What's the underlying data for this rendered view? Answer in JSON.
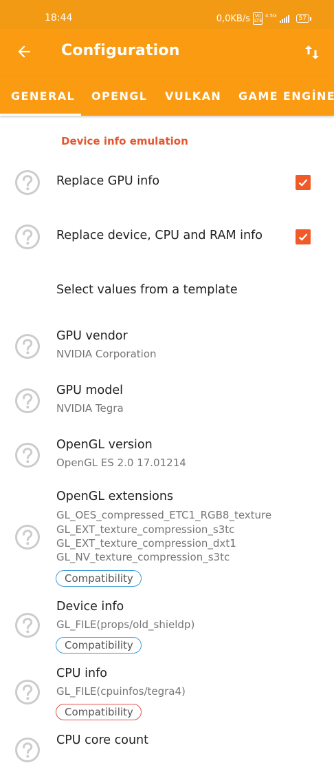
{
  "status_bar": {
    "time": "18:44",
    "speed": "0,0KB/s",
    "volte": "Vo LTE",
    "network": "4.5G",
    "battery": "57"
  },
  "app_bar": {
    "title": "Configuration",
    "back_icon": "arrow-left-icon",
    "sort_icon": "swap-vertical-icon"
  },
  "tabs": [
    {
      "label": "GENERAL",
      "selected": true
    },
    {
      "label": "OPENGL",
      "selected": false
    },
    {
      "label": "VULKAN",
      "selected": false
    },
    {
      "label": "GAME ENGİNE",
      "selected": false
    }
  ],
  "section": {
    "title": "Device info emulation"
  },
  "settings": {
    "replace_gpu": {
      "title": "Replace GPU info",
      "checked": true
    },
    "replace_device": {
      "title": "Replace device, CPU and RAM info",
      "checked": true
    },
    "template": {
      "title": "Select values from a template"
    },
    "gpu_vendor": {
      "title": "GPU vendor",
      "value": "NVIDIA Corporation"
    },
    "gpu_model": {
      "title": "GPU model",
      "value": "NVIDIA Tegra"
    },
    "opengl_version": {
      "title": "OpenGL version",
      "value": "OpenGL ES 2.0 17.01214"
    },
    "opengl_extensions": {
      "title": "OpenGL extensions",
      "values": [
        "GL_OES_compressed_ETC1_RGB8_texture",
        "GL_EXT_texture_compression_s3tc",
        "GL_EXT_texture_compression_dxt1",
        "GL_NV_texture_compression_s3tc"
      ],
      "badge": "Compatibility"
    },
    "device_info": {
      "title": "Device info",
      "value": "GL_FILE(props/old_shieldp)",
      "badge": "Compatibility"
    },
    "cpu_info": {
      "title": "CPU info",
      "value": "GL_FILE(cpuinfos/tegra4)",
      "badge": "Compatibility"
    },
    "cpu_core_count": {
      "title": "CPU core count"
    }
  },
  "colors": {
    "status_bar": "#f39a14",
    "app_bar": "#fa9b12",
    "accent": "#e4572e",
    "checkbox": "#f05a28",
    "badge_blue": "#3a9ad9",
    "badge_red": "#e0504a"
  },
  "icons": {
    "help": "help-circle-icon",
    "check": "checkmark-icon"
  }
}
